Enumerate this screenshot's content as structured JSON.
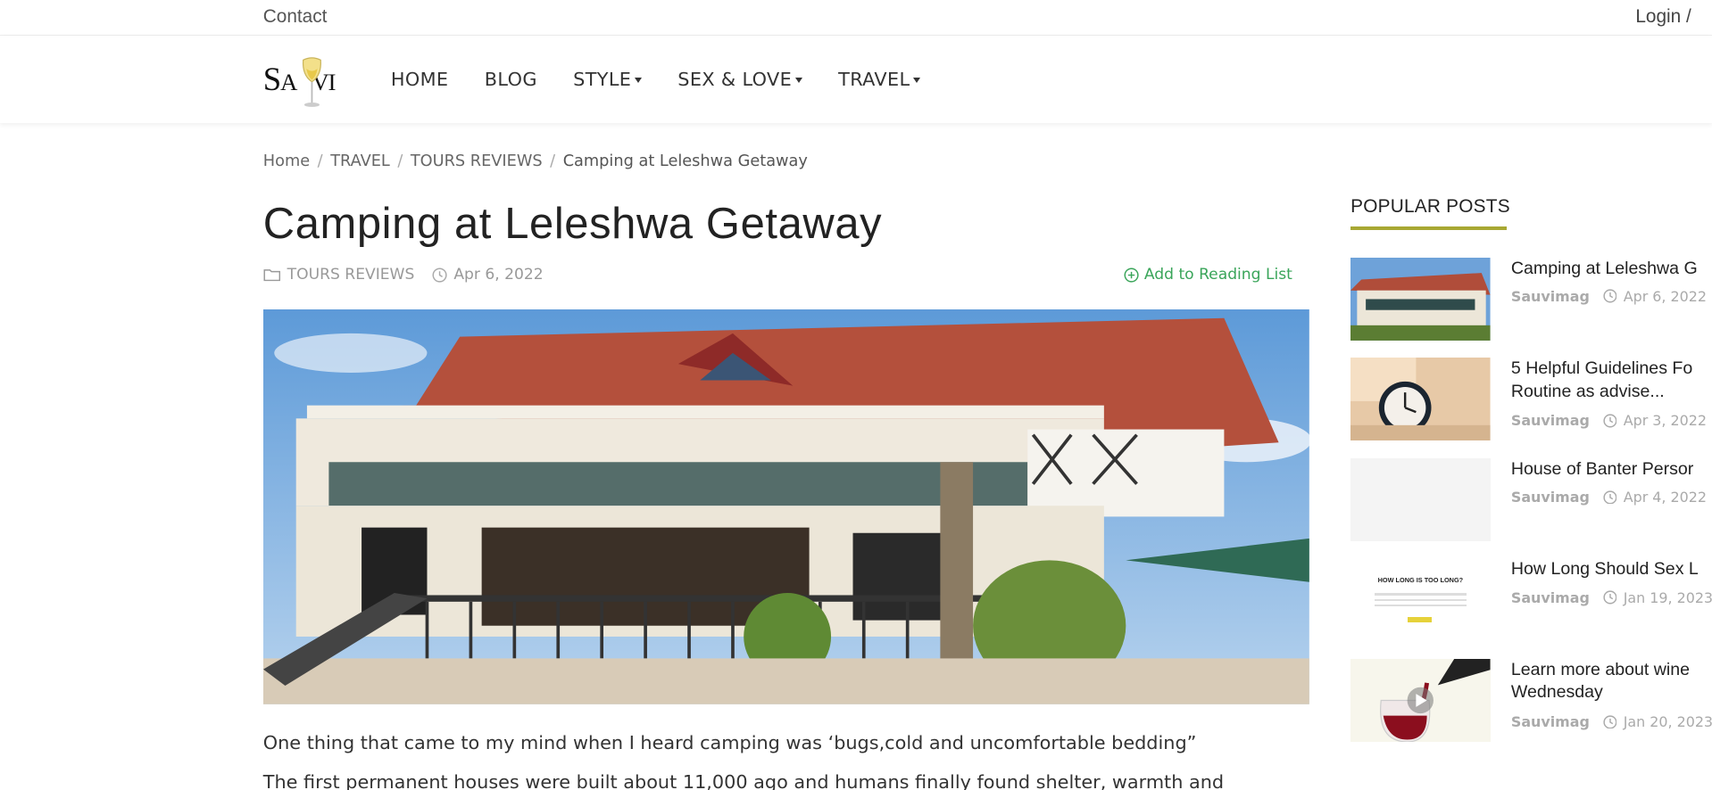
{
  "topbar": {
    "contact": "Contact",
    "login": "Login  /"
  },
  "brand": {
    "logo_text_big": "S",
    "logo_text_small": "A",
    "logo_text_end": "VI"
  },
  "nav": [
    {
      "label": "HOME",
      "dropdown": false
    },
    {
      "label": "BLOG",
      "dropdown": false
    },
    {
      "label": "STYLE",
      "dropdown": true
    },
    {
      "label": "SEX & LOVE",
      "dropdown": true
    },
    {
      "label": "TRAVEL",
      "dropdown": true
    }
  ],
  "breadcrumb": [
    "Home",
    "TRAVEL",
    "TOURS REVIEWS",
    "Camping at Leleshwa Getaway"
  ],
  "article": {
    "title": "Camping at Leleshwa Getaway",
    "category": "TOURS REVIEWS",
    "date": "Apr 6, 2022",
    "reading_list": "Add to Reading List",
    "paragraph1": "One thing that came to my mind when I heard camping was ‘bugs,cold and uncomfortable bedding”",
    "paragraph2": "The first permanent houses were built about 11,000 ago and humans finally found shelter, warmth and"
  },
  "sidebar": {
    "heading": "POPULAR POSTS",
    "posts": [
      {
        "title1": "Camping at Leleshwa G",
        "title2": "",
        "author": "Sauvimag",
        "date": "Apr 6, 2022",
        "thumb": "house-photo"
      },
      {
        "title1": "5 Helpful Guidelines Fo",
        "title2": "Routine as advise...",
        "author": "Sauvimag",
        "date": "Apr 3, 2022",
        "thumb": "clock-photo"
      },
      {
        "title1": "House of Banter Persor",
        "title2": "",
        "author": "Sauvimag",
        "date": "Apr 4, 2022",
        "thumb": "blank"
      },
      {
        "title1": "How Long Should Sex L",
        "title2": "",
        "author": "Sauvimag",
        "date": "Jan 19, 2023",
        "thumb": "text-card",
        "thumb_text": "HOW LONG IS TOO LONG?"
      },
      {
        "title1": "Learn more about wine",
        "title2": "Wednesday",
        "author": "Sauvimag",
        "date": "Jan 20, 2023",
        "thumb": "wine-video"
      }
    ]
  },
  "colors": {
    "accent_green": "#3aa55a",
    "sidebar_rule": "#a8a833"
  }
}
